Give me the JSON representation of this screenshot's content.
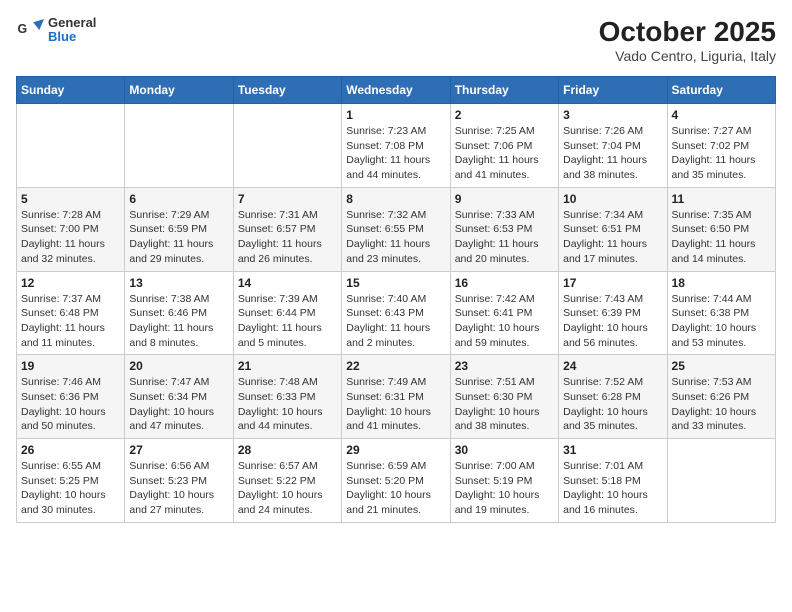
{
  "header": {
    "logo_line1": "General",
    "logo_line2": "Blue",
    "title": "October 2025",
    "subtitle": "Vado Centro, Liguria, Italy"
  },
  "weekdays": [
    "Sunday",
    "Monday",
    "Tuesday",
    "Wednesday",
    "Thursday",
    "Friday",
    "Saturday"
  ],
  "weeks": [
    [
      {
        "day": "",
        "info": ""
      },
      {
        "day": "",
        "info": ""
      },
      {
        "day": "",
        "info": ""
      },
      {
        "day": "1",
        "info": "Sunrise: 7:23 AM\nSunset: 7:08 PM\nDaylight: 11 hours and 44 minutes."
      },
      {
        "day": "2",
        "info": "Sunrise: 7:25 AM\nSunset: 7:06 PM\nDaylight: 11 hours and 41 minutes."
      },
      {
        "day": "3",
        "info": "Sunrise: 7:26 AM\nSunset: 7:04 PM\nDaylight: 11 hours and 38 minutes."
      },
      {
        "day": "4",
        "info": "Sunrise: 7:27 AM\nSunset: 7:02 PM\nDaylight: 11 hours and 35 minutes."
      }
    ],
    [
      {
        "day": "5",
        "info": "Sunrise: 7:28 AM\nSunset: 7:00 PM\nDaylight: 11 hours and 32 minutes."
      },
      {
        "day": "6",
        "info": "Sunrise: 7:29 AM\nSunset: 6:59 PM\nDaylight: 11 hours and 29 minutes."
      },
      {
        "day": "7",
        "info": "Sunrise: 7:31 AM\nSunset: 6:57 PM\nDaylight: 11 hours and 26 minutes."
      },
      {
        "day": "8",
        "info": "Sunrise: 7:32 AM\nSunset: 6:55 PM\nDaylight: 11 hours and 23 minutes."
      },
      {
        "day": "9",
        "info": "Sunrise: 7:33 AM\nSunset: 6:53 PM\nDaylight: 11 hours and 20 minutes."
      },
      {
        "day": "10",
        "info": "Sunrise: 7:34 AM\nSunset: 6:51 PM\nDaylight: 11 hours and 17 minutes."
      },
      {
        "day": "11",
        "info": "Sunrise: 7:35 AM\nSunset: 6:50 PM\nDaylight: 11 hours and 14 minutes."
      }
    ],
    [
      {
        "day": "12",
        "info": "Sunrise: 7:37 AM\nSunset: 6:48 PM\nDaylight: 11 hours and 11 minutes."
      },
      {
        "day": "13",
        "info": "Sunrise: 7:38 AM\nSunset: 6:46 PM\nDaylight: 11 hours and 8 minutes."
      },
      {
        "day": "14",
        "info": "Sunrise: 7:39 AM\nSunset: 6:44 PM\nDaylight: 11 hours and 5 minutes."
      },
      {
        "day": "15",
        "info": "Sunrise: 7:40 AM\nSunset: 6:43 PM\nDaylight: 11 hours and 2 minutes."
      },
      {
        "day": "16",
        "info": "Sunrise: 7:42 AM\nSunset: 6:41 PM\nDaylight: 10 hours and 59 minutes."
      },
      {
        "day": "17",
        "info": "Sunrise: 7:43 AM\nSunset: 6:39 PM\nDaylight: 10 hours and 56 minutes."
      },
      {
        "day": "18",
        "info": "Sunrise: 7:44 AM\nSunset: 6:38 PM\nDaylight: 10 hours and 53 minutes."
      }
    ],
    [
      {
        "day": "19",
        "info": "Sunrise: 7:46 AM\nSunset: 6:36 PM\nDaylight: 10 hours and 50 minutes."
      },
      {
        "day": "20",
        "info": "Sunrise: 7:47 AM\nSunset: 6:34 PM\nDaylight: 10 hours and 47 minutes."
      },
      {
        "day": "21",
        "info": "Sunrise: 7:48 AM\nSunset: 6:33 PM\nDaylight: 10 hours and 44 minutes."
      },
      {
        "day": "22",
        "info": "Sunrise: 7:49 AM\nSunset: 6:31 PM\nDaylight: 10 hours and 41 minutes."
      },
      {
        "day": "23",
        "info": "Sunrise: 7:51 AM\nSunset: 6:30 PM\nDaylight: 10 hours and 38 minutes."
      },
      {
        "day": "24",
        "info": "Sunrise: 7:52 AM\nSunset: 6:28 PM\nDaylight: 10 hours and 35 minutes."
      },
      {
        "day": "25",
        "info": "Sunrise: 7:53 AM\nSunset: 6:26 PM\nDaylight: 10 hours and 33 minutes."
      }
    ],
    [
      {
        "day": "26",
        "info": "Sunrise: 6:55 AM\nSunset: 5:25 PM\nDaylight: 10 hours and 30 minutes."
      },
      {
        "day": "27",
        "info": "Sunrise: 6:56 AM\nSunset: 5:23 PM\nDaylight: 10 hours and 27 minutes."
      },
      {
        "day": "28",
        "info": "Sunrise: 6:57 AM\nSunset: 5:22 PM\nDaylight: 10 hours and 24 minutes."
      },
      {
        "day": "29",
        "info": "Sunrise: 6:59 AM\nSunset: 5:20 PM\nDaylight: 10 hours and 21 minutes."
      },
      {
        "day": "30",
        "info": "Sunrise: 7:00 AM\nSunset: 5:19 PM\nDaylight: 10 hours and 19 minutes."
      },
      {
        "day": "31",
        "info": "Sunrise: 7:01 AM\nSunset: 5:18 PM\nDaylight: 10 hours and 16 minutes."
      },
      {
        "day": "",
        "info": ""
      }
    ]
  ]
}
